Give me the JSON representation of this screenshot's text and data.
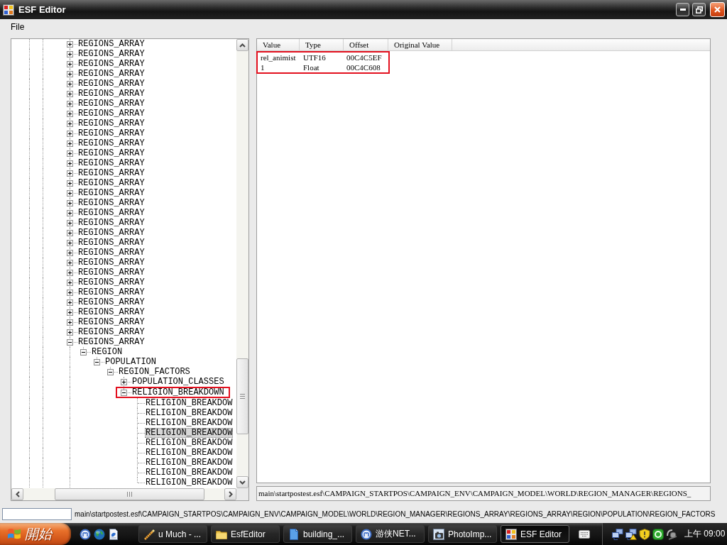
{
  "window": {
    "title": "ESF Editor"
  },
  "menu": [
    {
      "label": "File"
    }
  ],
  "tree": {
    "items": [
      {
        "label": "REGIONS_ARRAY",
        "expanded": false,
        "selected": false,
        "marked": false
      },
      {
        "label": "REGIONS_ARRAY",
        "expanded": false,
        "selected": false,
        "marked": false
      },
      {
        "label": "REGIONS_ARRAY",
        "expanded": false,
        "selected": false,
        "marked": false
      },
      {
        "label": "REGIONS_ARRAY",
        "expanded": false,
        "selected": false,
        "marked": false
      },
      {
        "label": "REGIONS_ARRAY",
        "expanded": false,
        "selected": false,
        "marked": false
      },
      {
        "label": "REGIONS_ARRAY",
        "expanded": false,
        "selected": false,
        "marked": false
      },
      {
        "label": "REGIONS_ARRAY",
        "expanded": false,
        "selected": false,
        "marked": false
      },
      {
        "label": "REGIONS_ARRAY",
        "expanded": false,
        "selected": false,
        "marked": false
      },
      {
        "label": "REGIONS_ARRAY",
        "expanded": false,
        "selected": false,
        "marked": false
      },
      {
        "label": "REGIONS_ARRAY",
        "expanded": false,
        "selected": false,
        "marked": false
      },
      {
        "label": "REGIONS_ARRAY",
        "expanded": false,
        "selected": false,
        "marked": false
      },
      {
        "label": "REGIONS_ARRAY",
        "expanded": false,
        "selected": false,
        "marked": false
      },
      {
        "label": "REGIONS_ARRAY",
        "expanded": false,
        "selected": false,
        "marked": false
      },
      {
        "label": "REGIONS_ARRAY",
        "expanded": false,
        "selected": false,
        "marked": false
      },
      {
        "label": "REGIONS_ARRAY",
        "expanded": false,
        "selected": false,
        "marked": false
      },
      {
        "label": "REGIONS_ARRAY",
        "expanded": false,
        "selected": false,
        "marked": false
      },
      {
        "label": "REGIONS_ARRAY",
        "expanded": false,
        "selected": false,
        "marked": false
      },
      {
        "label": "REGIONS_ARRAY",
        "expanded": false,
        "selected": false,
        "marked": false
      },
      {
        "label": "REGIONS_ARRAY",
        "expanded": false,
        "selected": false,
        "marked": false
      },
      {
        "label": "REGIONS_ARRAY",
        "expanded": false,
        "selected": false,
        "marked": false
      },
      {
        "label": "REGIONS_ARRAY",
        "expanded": false,
        "selected": false,
        "marked": false
      },
      {
        "label": "REGIONS_ARRAY",
        "expanded": false,
        "selected": false,
        "marked": false
      },
      {
        "label": "REGIONS_ARRAY",
        "expanded": false,
        "selected": false,
        "marked": false
      },
      {
        "label": "REGIONS_ARRAY",
        "expanded": false,
        "selected": false,
        "marked": false
      },
      {
        "label": "REGIONS_ARRAY",
        "expanded": false,
        "selected": false,
        "marked": false
      },
      {
        "label": "REGIONS_ARRAY",
        "expanded": false,
        "selected": false,
        "marked": false
      },
      {
        "label": "REGIONS_ARRAY",
        "expanded": false,
        "selected": false,
        "marked": false
      },
      {
        "label": "REGIONS_ARRAY",
        "expanded": false,
        "selected": false,
        "marked": false
      },
      {
        "label": "REGIONS_ARRAY",
        "expanded": false,
        "selected": false,
        "marked": false
      },
      {
        "label": "REGIONS_ARRAY",
        "expanded": false,
        "selected": false,
        "marked": false
      },
      {
        "label": "REGIONS_ARRAY",
        "expanded": true,
        "selected": false,
        "marked": false,
        "children": [
          {
            "label": "REGION",
            "expanded": true,
            "selected": false,
            "marked": false,
            "children": [
              {
                "label": "POPULATION",
                "expanded": true,
                "selected": false,
                "marked": false,
                "children": [
                  {
                    "label": "REGION_FACTORS",
                    "expanded": true,
                    "selected": false,
                    "marked": false,
                    "children": [
                      {
                        "label": "POPULATION_CLASSES",
                        "expanded": false,
                        "selected": false,
                        "marked": false
                      },
                      {
                        "label": "RELIGION_BREAKDOWN",
                        "expanded": true,
                        "selected": false,
                        "marked": true,
                        "children": [
                          {
                            "label": "RELIGION_BREAKDOW",
                            "selected": false,
                            "marked": false
                          },
                          {
                            "label": "RELIGION_BREAKDOW",
                            "selected": false,
                            "marked": false
                          },
                          {
                            "label": "RELIGION_BREAKDOW",
                            "selected": false,
                            "marked": false
                          },
                          {
                            "label": "RELIGION_BREAKDOW",
                            "selected": true,
                            "marked": false
                          },
                          {
                            "label": "RELIGION_BREAKDOW",
                            "selected": false,
                            "marked": false
                          },
                          {
                            "label": "RELIGION_BREAKDOW",
                            "selected": false,
                            "marked": false
                          },
                          {
                            "label": "RELIGION_BREAKDOW",
                            "selected": false,
                            "marked": false
                          },
                          {
                            "label": "RELIGION_BREAKDOW",
                            "selected": false,
                            "marked": false
                          },
                          {
                            "label": "RELIGION_BREAKDOW",
                            "selected": false,
                            "marked": false
                          }
                        ]
                      }
                    ]
                  }
                ]
              }
            ]
          }
        ]
      }
    ]
  },
  "list": {
    "columns": [
      "Value",
      "Type",
      "Offset",
      "Original Value"
    ],
    "rows": [
      {
        "cells": [
          "rel_animist",
          "UTF16",
          "00C4C5EF"
        ],
        "selected": false,
        "marked": true
      },
      {
        "cells": [
          "1",
          "Float",
          "00C4C608"
        ],
        "selected": false,
        "marked": true
      }
    ]
  },
  "path_field": {
    "value": "main\\startpostest.esf\\CAMPAIGN_STARTPOS\\CAMPAIGN_ENV\\CAMPAIGN_MODEL\\WORLD\\REGION_MANAGER\\REGIONS_"
  },
  "status_bar": {
    "path": "main\\startpostest.esf\\CAMPAIGN_STARTPOS\\CAMPAIGN_ENV\\CAMPAIGN_MODEL\\WORLD\\REGION_MANAGER\\REGIONS_ARRAY\\REGIONS_ARRAY\\REGION\\POPULATION\\REGION_FACTORS"
  },
  "taskbar": {
    "start": {
      "label": "開始"
    },
    "tasks": [
      {
        "label": "u Much - ...",
        "selected": false
      },
      {
        "label": "EsfEditor",
        "selected": false
      },
      {
        "label": "building_...",
        "selected": false
      },
      {
        "label": "游侠NET...",
        "selected": false
      },
      {
        "label": "PhotoImp...",
        "selected": false
      },
      {
        "label": "ESF Editor",
        "selected": true
      }
    ],
    "clock": "上午 09:00"
  }
}
